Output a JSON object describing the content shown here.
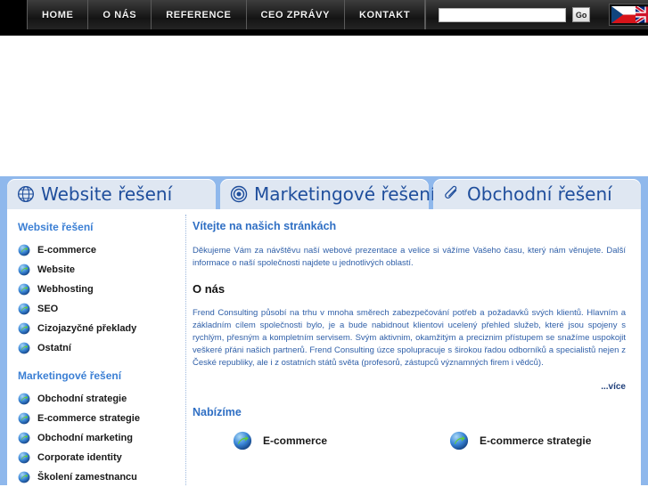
{
  "topnav": {
    "items": [
      {
        "label": "HOME"
      },
      {
        "label": "O NÁS"
      },
      {
        "label": "REFERENCE"
      },
      {
        "label": "CEO ZPRÁVY"
      },
      {
        "label": "KONTAKT"
      }
    ],
    "search": {
      "value": "",
      "placeholder": "",
      "button_label": "Go"
    },
    "flags": [
      {
        "name": "czech-flag",
        "alt": "Čeština"
      },
      {
        "name": "uk-flag",
        "alt": "English"
      }
    ]
  },
  "tabs": [
    {
      "label": "Website řešení",
      "icon": "globe-icon"
    },
    {
      "label": "Marketingové řešení",
      "icon": "target-icon"
    },
    {
      "label": "Obchodní řešení",
      "icon": "paperclip-icon"
    }
  ],
  "sidebar": {
    "groups": [
      {
        "title": "Website řešení",
        "items": [
          {
            "label": "E-commerce"
          },
          {
            "label": "Website"
          },
          {
            "label": "Webhosting"
          },
          {
            "label": "SEO"
          },
          {
            "label": "Cizojazyčné překlady"
          },
          {
            "label": "Ostatní"
          }
        ]
      },
      {
        "title": "Marketingové řešení",
        "items": [
          {
            "label": "Obchodní strategie"
          },
          {
            "label": "E-commerce strategie"
          },
          {
            "label": "Obchodní marketing"
          },
          {
            "label": "Corporate identity"
          },
          {
            "label": "Školení zamestnancu"
          }
        ]
      }
    ]
  },
  "main": {
    "welcome_heading": "Vítejte na našich stránkách",
    "welcome_text": "Děkujeme Vám za návštěvu naší webové prezentace a velice si vážíme Vašeho času, který nám věnujete. Další informace o naší společnosti najdete u jednotlivých oblastí.",
    "about_heading": "O nás",
    "about_text": "Frend Consulting působí na trhu v mnoha směrech zabezpečování potřeb a požadavků svých klientů. Hlavním a základním cílem společnosti bylo, je a bude nabidnout klientovi ucelený přehled služeb, které jsou spojeny s rychlým, přesným a kompletním servisem. Svým aktivnim, okamžitým a preciznim přístupem se snažíme uspokojit veškeré přáni našich partnerů. Frend Consulting úzce spolupracuje s širokou řadou odborníků a specialistů nejen z České republiky, ale i z ostatních států světa (profesorů, zástupců významných firem i vědců).",
    "more_label": "...více",
    "offer_heading": "Nabízíme",
    "offers": [
      {
        "label": "E-commerce"
      },
      {
        "label": "E-commerce strategie"
      }
    ]
  },
  "colors": {
    "frame_blue": "#8fb8ec",
    "tab_bg": "#dfe7f2",
    "tab_text": "#1f4e9c",
    "heading_blue": "#2f6fc4",
    "body_blue": "#2f5fa8",
    "nav_bg": "#141414",
    "nav_text": "#f2f2f2"
  }
}
